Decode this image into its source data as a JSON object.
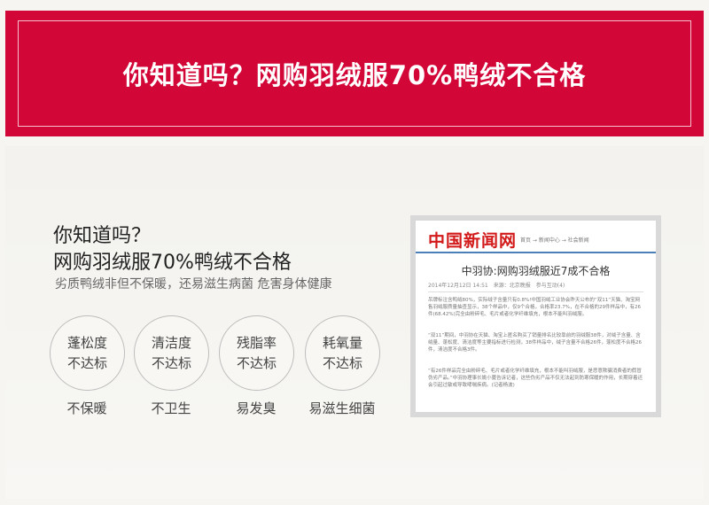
{
  "banner": {
    "title": "你知道吗？网购羽绒服70%鸭绒不合格"
  },
  "intro": {
    "line1": "你知道吗？",
    "line2": "网购羽绒服70%鸭绒不合格",
    "subtitle": "劣质鸭绒非但不保暖，还易滋生病菌 危害身体健康"
  },
  "metrics": [
    {
      "name": "蓬松度",
      "status": "不达标",
      "effect": "不保暖"
    },
    {
      "name": "清洁度",
      "status": "不达标",
      "effect": "不卫生"
    },
    {
      "name": "残脂率",
      "status": "不达标",
      "effect": "易发臭"
    },
    {
      "name": "耗氧量",
      "status": "不达标",
      "effect": "易滋生细菌"
    }
  ],
  "news": {
    "logo": "中国新闻网",
    "breadcrumb": "首页 → 新闻中心 → 社会新闻",
    "title": "中羽协:网购羽绒服近7成不合格",
    "meta": "2014年12月12日 14:51　来源：北京晚报　参与互动(4)",
    "paragraphs": [
      "吊牌标注含鸭绒80%，实际绒子含量只有0.8%!中国羽绒工业协会昨天公布的“双11”天猫、淘宝网售羽绒服质量抽查显示，38个样品中，仅9个合格，合格率23.7%，在不合格的29件样品中，有26件(68.42%)完全由粉碎毛、毛片或者化学纤维填充，根本不能叫羽绒服。",
      "“双11”期间，中羽协在天猫、淘宝上匿名购买了销量排名比较靠前的羽绒服38件，对绒子含量、含绒量、蓬松度、清洁度等主要指标进行检测，38件样品中，绒子含量不合格26件，蓬松度不合格26件，清洁度不合格3件。",
      "“有26件样品完全由粉碎毛、毛片或者化学纤维填充，根本不能叫羽绒服，是恶意欺骗消费者的假冒伪劣产品。”中羽协理事长姚小蔓告诉记者，这些伪劣产品不仅无法起到防寒保暖的作用，长期穿着还会引起过敏或导致哮喘疾病。(记者杨波)"
    ]
  }
}
